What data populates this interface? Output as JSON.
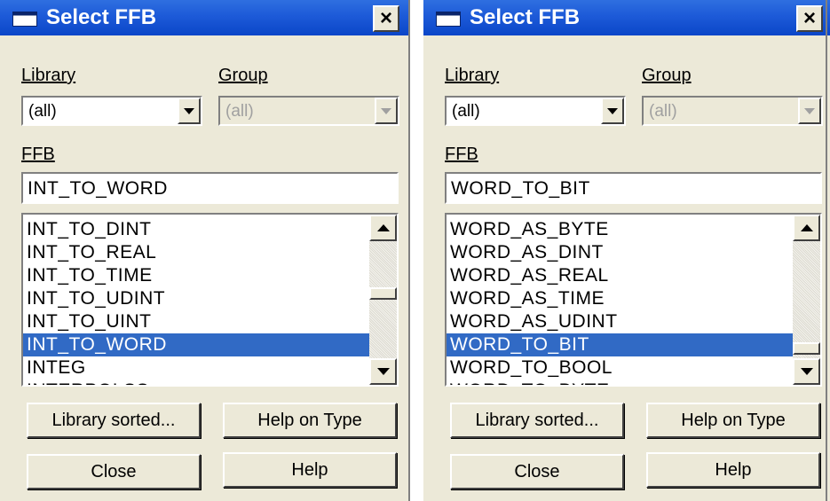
{
  "dialogs": [
    {
      "title": "Select FFB",
      "close_glyph": "×",
      "library_label": "Library",
      "group_label": "Group",
      "library_value": "(all)",
      "group_value": "(all)",
      "ffb_label": "FFB",
      "ffb_value": "INT_TO_WORD",
      "list_items": [
        "INT_TO_DINT",
        "INT_TO_REAL",
        "INT_TO_TIME",
        "INT_TO_UDINT",
        "INT_TO_UINT",
        "INT_TO_WORD",
        "INTEG",
        "INTERPOLSS"
      ],
      "selected_item": "INT_TO_WORD",
      "scroll_position": 0.45,
      "buttons": {
        "library_sorted": "Library sorted...",
        "help_on_type": "Help on Type",
        "close": "Close",
        "help": "Help"
      }
    },
    {
      "title": "Select FFB",
      "close_glyph": "×",
      "library_label": "Library",
      "group_label": "Group",
      "library_value": "(all)",
      "group_value": "(all)",
      "ffb_label": "FFB",
      "ffb_value": "WORD_TO_BIT",
      "list_items": [
        "WORD_AS_BYTE",
        "WORD_AS_DINT",
        "WORD_AS_REAL",
        "WORD_AS_TIME",
        "WORD_AS_UDINT",
        "WORD_TO_BIT",
        "WORD_TO_BOOL",
        "WORD_TO_BYTE"
      ],
      "selected_item": "WORD_TO_BIT",
      "scroll_position": 0.92,
      "buttons": {
        "library_sorted": "Library sorted...",
        "help_on_type": "Help on Type",
        "close": "Close",
        "help": "Help"
      }
    }
  ],
  "colors": {
    "titlebar": "#0a46c8",
    "selection": "#316ac5",
    "dialog_bg": "#ece9d8"
  },
  "icons": {
    "window": "window-icon",
    "close": "close-icon",
    "dropdown": "dropdown-arrow-icon",
    "scroll_up": "scroll-up-icon",
    "scroll_down": "scroll-down-icon"
  }
}
